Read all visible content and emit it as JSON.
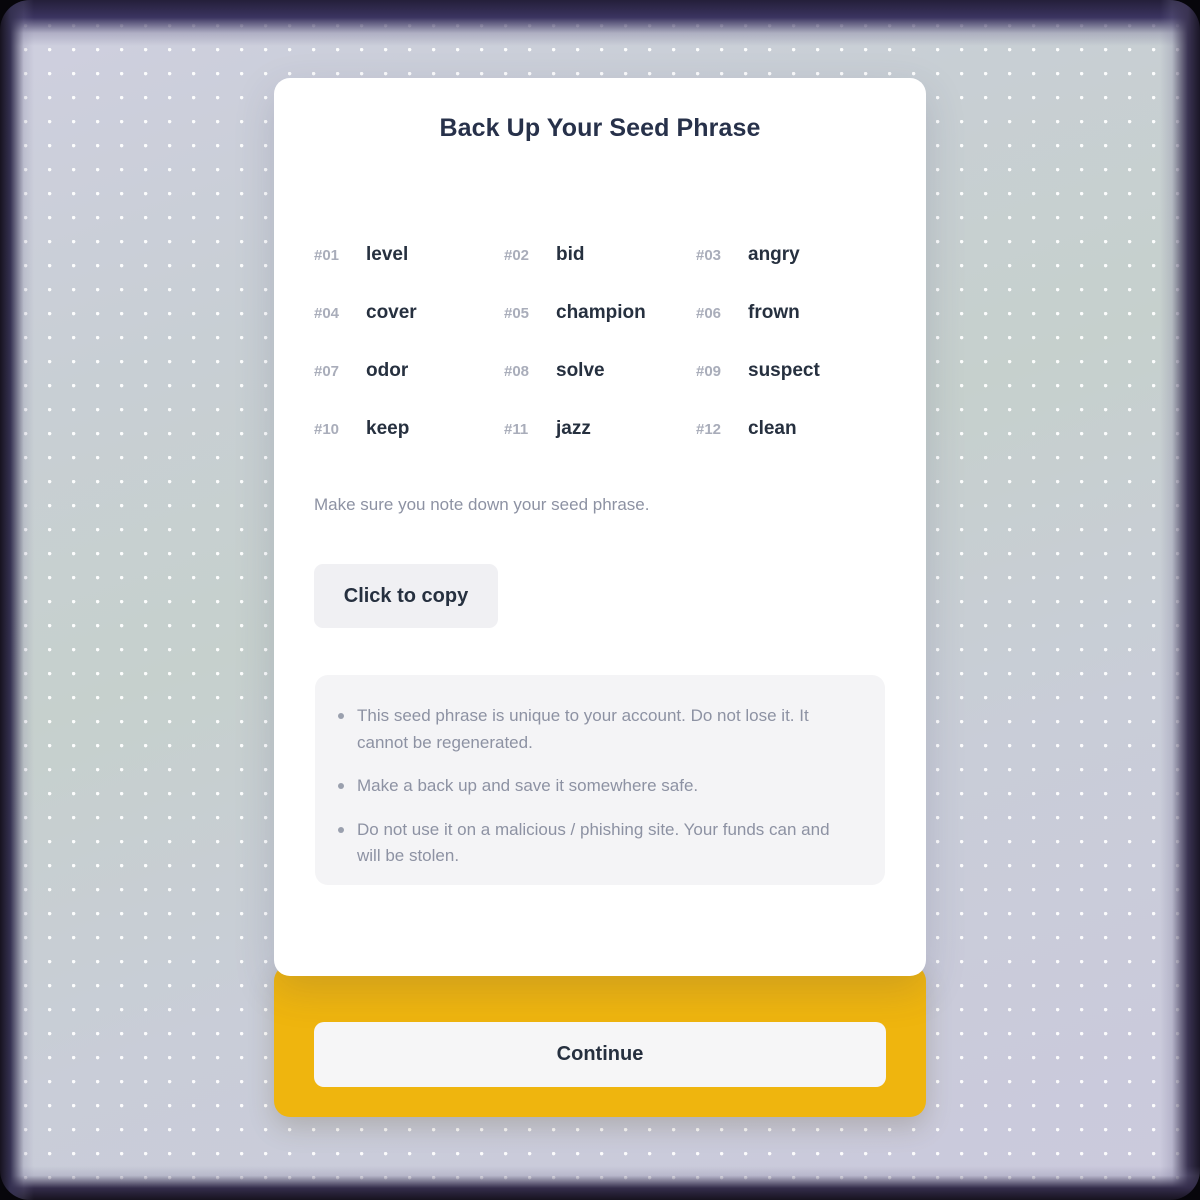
{
  "card": {
    "title": "Back Up Your Seed Phrase",
    "note": "Make sure you note down your seed phrase.",
    "copy_button_label": "Click to copy",
    "continue_button_label": "Continue"
  },
  "seed_phrase": {
    "words": [
      {
        "index": "#01",
        "word": "level"
      },
      {
        "index": "#02",
        "word": "bid"
      },
      {
        "index": "#03",
        "word": "angry"
      },
      {
        "index": "#04",
        "word": "cover"
      },
      {
        "index": "#05",
        "word": "champion"
      },
      {
        "index": "#06",
        "word": "frown"
      },
      {
        "index": "#07",
        "word": "odor"
      },
      {
        "index": "#08",
        "word": "solve"
      },
      {
        "index": "#09",
        "word": "suspect"
      },
      {
        "index": "#10",
        "word": "keep"
      },
      {
        "index": "#11",
        "word": "jazz"
      },
      {
        "index": "#12",
        "word": "clean"
      }
    ]
  },
  "warnings": [
    "This seed phrase is unique to your account. Do not lose it. It cannot be regenerated.",
    "Make a back up and save it somewhere safe.",
    "Do not use it on a malicious / phishing site. Your funds can and will be stolen."
  ],
  "colors": {
    "accent_yellow": "#efb50e",
    "card_background": "#ffffff",
    "text_dark": "#26303f",
    "text_muted": "#8d92a3",
    "index_gray": "#a9adba",
    "soft_gray": "#f0f0f3",
    "warning_box": "#f4f4f6",
    "page_background": "#c8cdd8"
  }
}
